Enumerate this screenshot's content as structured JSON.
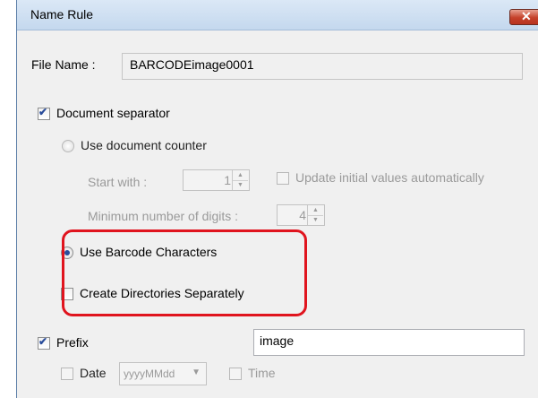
{
  "dialog": {
    "title": "Name Rule",
    "close_icon": "close-icon"
  },
  "file_name": {
    "label": "File Name :",
    "value": "BARCODEimage0001"
  },
  "document_separator": {
    "label": "Document separator",
    "checked": true
  },
  "use_document_counter": {
    "label": "Use document counter",
    "selected": false
  },
  "start_with": {
    "label": "Start with :",
    "value": "1"
  },
  "update_initial": {
    "label": "Update initial values automatically",
    "checked": false
  },
  "min_digits": {
    "label": "Minimum number of digits :",
    "value": "4"
  },
  "use_barcode_characters": {
    "label": "Use Barcode Characters",
    "selected": true
  },
  "create_directories": {
    "label": "Create Directories Separately",
    "checked": false
  },
  "prefix": {
    "label": "Prefix",
    "checked": true,
    "value": "image"
  },
  "date": {
    "label": "Date",
    "checked": false,
    "format": "yyyyMMdd"
  },
  "time": {
    "label": "Time",
    "checked": false
  },
  "colors": {
    "highlight": "#e0141e",
    "check_accent": "#2a4d9b"
  }
}
